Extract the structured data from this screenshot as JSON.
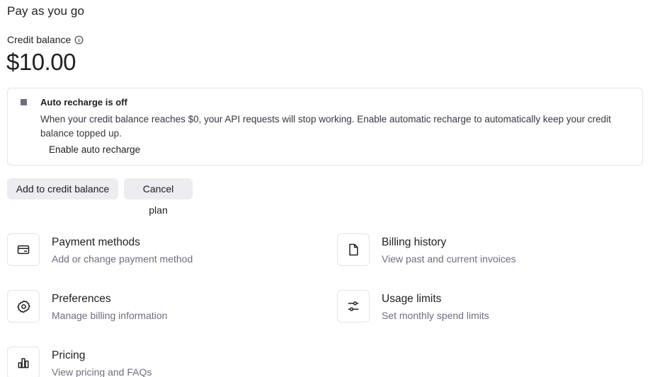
{
  "header": {
    "title": "Pay as you go"
  },
  "balance": {
    "label": "Credit balance",
    "info_icon": "info-icon",
    "amount": "$10.00"
  },
  "auto_recharge": {
    "status_color": "#6e6e80",
    "title": "Auto recharge is off",
    "description": "When your credit balance reaches $0, your API requests will stop working. Enable automatic recharge to automatically keep your credit balance topped up.",
    "link_label": "Enable auto recharge"
  },
  "actions": {
    "add_label": "Add to credit balance",
    "cancel_label": "Cancel plan"
  },
  "cards": [
    {
      "icon": "credit-card-icon",
      "title": "Payment methods",
      "subtitle": "Add or change payment method"
    },
    {
      "icon": "document-icon",
      "title": "Billing history",
      "subtitle": "View past and current invoices"
    },
    {
      "icon": "gear-icon",
      "title": "Preferences",
      "subtitle": "Manage billing information"
    },
    {
      "icon": "sliders-icon",
      "title": "Usage limits",
      "subtitle": "Set monthly spend limits"
    },
    {
      "icon": "bar-chart-icon",
      "title": "Pricing",
      "subtitle": "View pricing and FAQs"
    }
  ]
}
